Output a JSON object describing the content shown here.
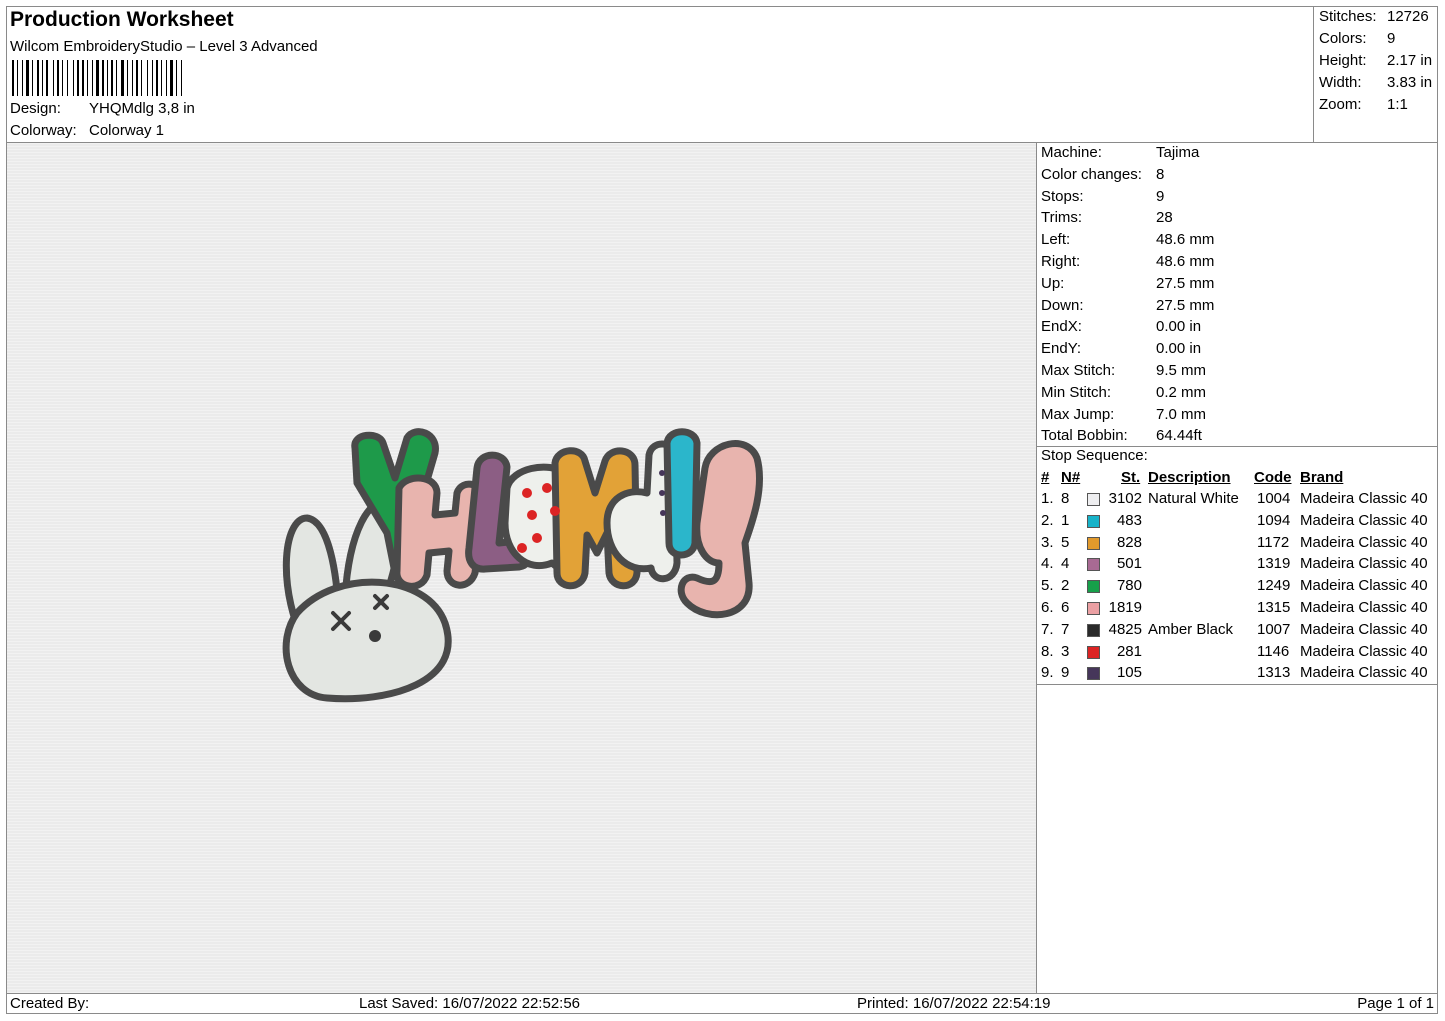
{
  "header": {
    "title": "Production Worksheet",
    "subtitle": "Wilcom EmbroideryStudio – Level 3 Advanced",
    "design_label": "Design:",
    "design_value": "YHQMdlg 3,8 in",
    "colorway_label": "Colorway:",
    "colorway_value": "Colorway 1"
  },
  "summary": [
    {
      "label": "Stitches:",
      "value": "12726"
    },
    {
      "label": "Colors:",
      "value": "9"
    },
    {
      "label": "Height:",
      "value": "2.17 in"
    },
    {
      "label": "Width:",
      "value": "3.83 in"
    },
    {
      "label": "Zoom:",
      "value": "1:1"
    }
  ],
  "machine_info": [
    {
      "label": "Machine:",
      "value": "Tajima"
    },
    {
      "label": "Color changes:",
      "value": "8"
    },
    {
      "label": "Stops:",
      "value": "9"
    },
    {
      "label": "Trims:",
      "value": "28"
    },
    {
      "label": "Left:",
      "value": "48.6 mm"
    },
    {
      "label": "Right:",
      "value": "48.6 mm"
    },
    {
      "label": "Up:",
      "value": "27.5 mm"
    },
    {
      "label": "Down:",
      "value": "27.5 mm"
    },
    {
      "label": "EndX:",
      "value": "0.00 in"
    },
    {
      "label": "EndY:",
      "value": "0.00 in"
    },
    {
      "label": "Max Stitch:",
      "value": "9.5 mm"
    },
    {
      "label": "Min Stitch:",
      "value": "0.2 mm"
    },
    {
      "label": "Max Jump:",
      "value": "7.0 mm"
    },
    {
      "label": "Total Bobbin:",
      "value": "64.44ft"
    }
  ],
  "stop_sequence": {
    "title": "Stop Sequence:",
    "headers": {
      "num": "#",
      "n": "N#",
      "st": "St.",
      "description": "Description",
      "code": "Code",
      "brand": "Brand"
    },
    "rows": [
      {
        "num": "1.",
        "n": "8",
        "color": "#eeeef0",
        "st": "3102",
        "description": "Natural White",
        "code": "1004",
        "brand": "Madeira Classic 40"
      },
      {
        "num": "2.",
        "n": "1",
        "color": "#18b3c9",
        "st": "483",
        "description": "",
        "code": "1094",
        "brand": "Madeira Classic 40"
      },
      {
        "num": "3.",
        "n": "5",
        "color": "#e29a2c",
        "st": "828",
        "description": "",
        "code": "1172",
        "brand": "Madeira Classic 40"
      },
      {
        "num": "4.",
        "n": "4",
        "color": "#a86a93",
        "st": "501",
        "description": "",
        "code": "1319",
        "brand": "Madeira Classic 40"
      },
      {
        "num": "5.",
        "n": "2",
        "color": "#17a04a",
        "st": "780",
        "description": "",
        "code": "1249",
        "brand": "Madeira Classic 40"
      },
      {
        "num": "6.",
        "n": "6",
        "color": "#eba0a3",
        "st": "1819",
        "description": "",
        "code": "1315",
        "brand": "Madeira Classic 40"
      },
      {
        "num": "7.",
        "n": "7",
        "color": "#2a2a2a",
        "st": "4825",
        "description": "Amber Black",
        "code": "1007",
        "brand": "Madeira Classic 40"
      },
      {
        "num": "8.",
        "n": "3",
        "color": "#dc2424",
        "st": "281",
        "description": "",
        "code": "1146",
        "brand": "Madeira Classic 40"
      },
      {
        "num": "9.",
        "n": "9",
        "color": "#46365a",
        "st": "105",
        "description": "",
        "code": "1313",
        "brand": "Madeira Classic 40"
      }
    ]
  },
  "footer": {
    "created_by": "Created By:",
    "last_saved": "Last Saved: 16/07/2022 22:52:56",
    "printed": "Printed: 16/07/2022 22:54:19",
    "page": "Page 1 of 1"
  }
}
